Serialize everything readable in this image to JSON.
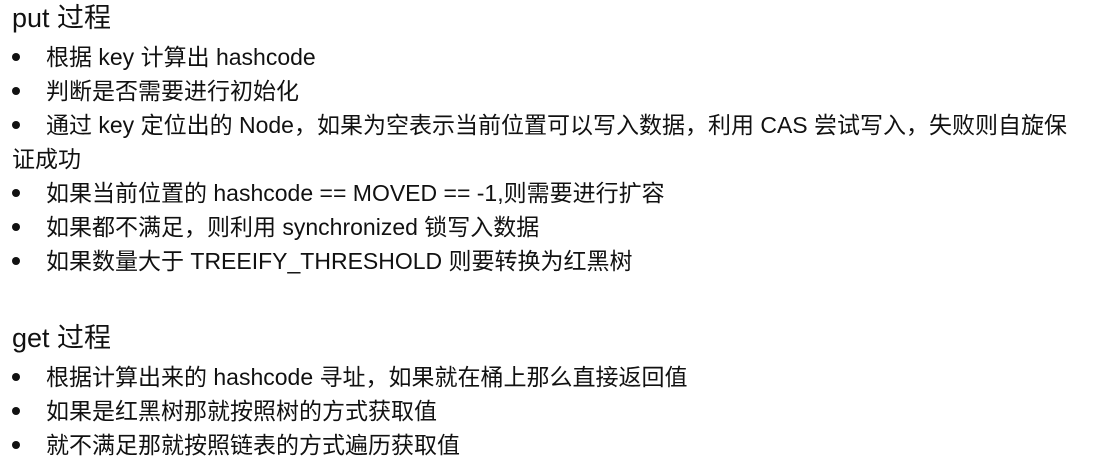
{
  "put_section": {
    "title": "put 过程",
    "items": [
      "根据 key 计算出 hashcode",
      "判断是否需要进行初始化",
      "通过 key 定位出的 Node，如果为空表示当前位置可以写入数据，利用 CAS 尝试写入，失败则自旋保证成功",
      "如果当前位置的 hashcode == MOVED == -1,则需要进行扩容",
      "如果都不满足，则利用 synchronized 锁写入数据",
      "如果数量大于 TREEIFY_THRESHOLD 则要转换为红黑树"
    ]
  },
  "get_section": {
    "title": "get 过程",
    "items": [
      "根据计算出来的 hashcode 寻址，如果就在桶上那么直接返回值",
      "如果是红黑树那就按照树的方式获取值",
      "就不满足那就按照链表的方式遍历获取值"
    ]
  }
}
